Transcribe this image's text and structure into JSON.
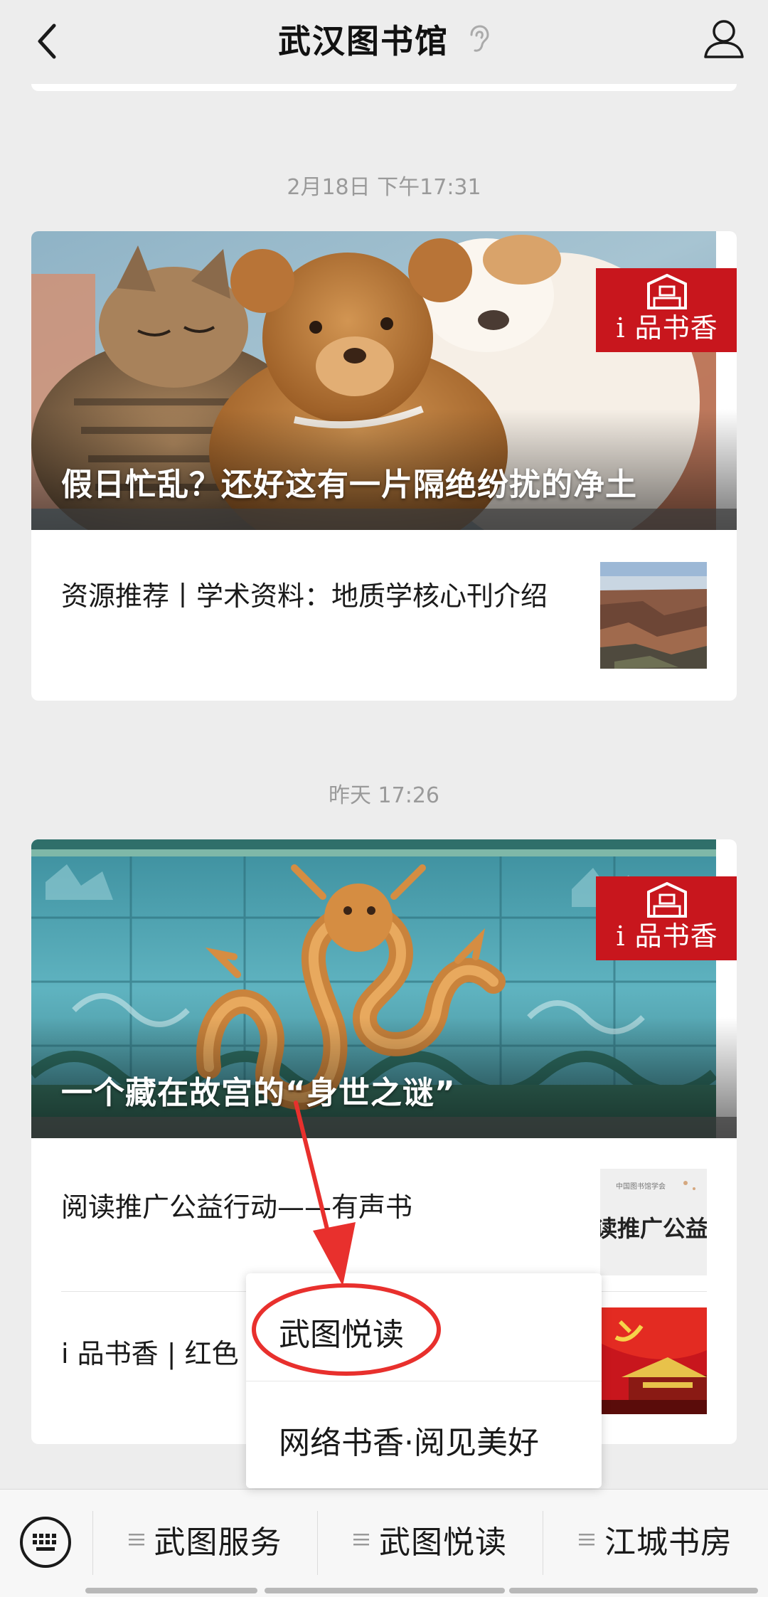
{
  "header": {
    "title": "武汉图书馆",
    "back_icon": "chevron-left-icon",
    "ear_icon": "ear-icon",
    "profile_icon": "user-icon"
  },
  "feed": [
    {
      "timestamp": "2月18日 下午17:31",
      "hero": {
        "title": "假日忙乱？还好这有一片隔绝纷扰的净土",
        "badge": "i 品书香",
        "image": "cat-teddy-bear-puppy-photo"
      },
      "items": [
        {
          "title": "资源推荐丨学术资料：地质学核心刊介绍",
          "thumb": "grand-canyon-photo"
        }
      ]
    },
    {
      "timestamp": "昨天 17:26",
      "hero": {
        "title": "一个藏在故宫的“身世之谜”",
        "badge": "i 品书香",
        "image": "nine-dragon-wall-photo"
      },
      "items": [
        {
          "title": "阅读推广公益行动——有声书",
          "thumb": "reading-promotion-thumb",
          "thumb_text": "读推广公益行",
          "thumb_small": "中国图书馆学会"
        },
        {
          "title": "i 品书香 | 红色",
          "thumb": "red-flag-tiananmen-thumb"
        }
      ]
    }
  ],
  "popup": {
    "items": [
      "武图悦读",
      "网络书香·阅见美好"
    ],
    "highlighted": "武图悦读"
  },
  "menu": {
    "keyboard_icon": "keyboard-icon",
    "buttons": [
      "武图服务",
      "武图悦读",
      "江城书房"
    ]
  },
  "colors": {
    "badge_red": "#c8161d",
    "annotation_red": "#e8302d",
    "background": "#ededed"
  }
}
